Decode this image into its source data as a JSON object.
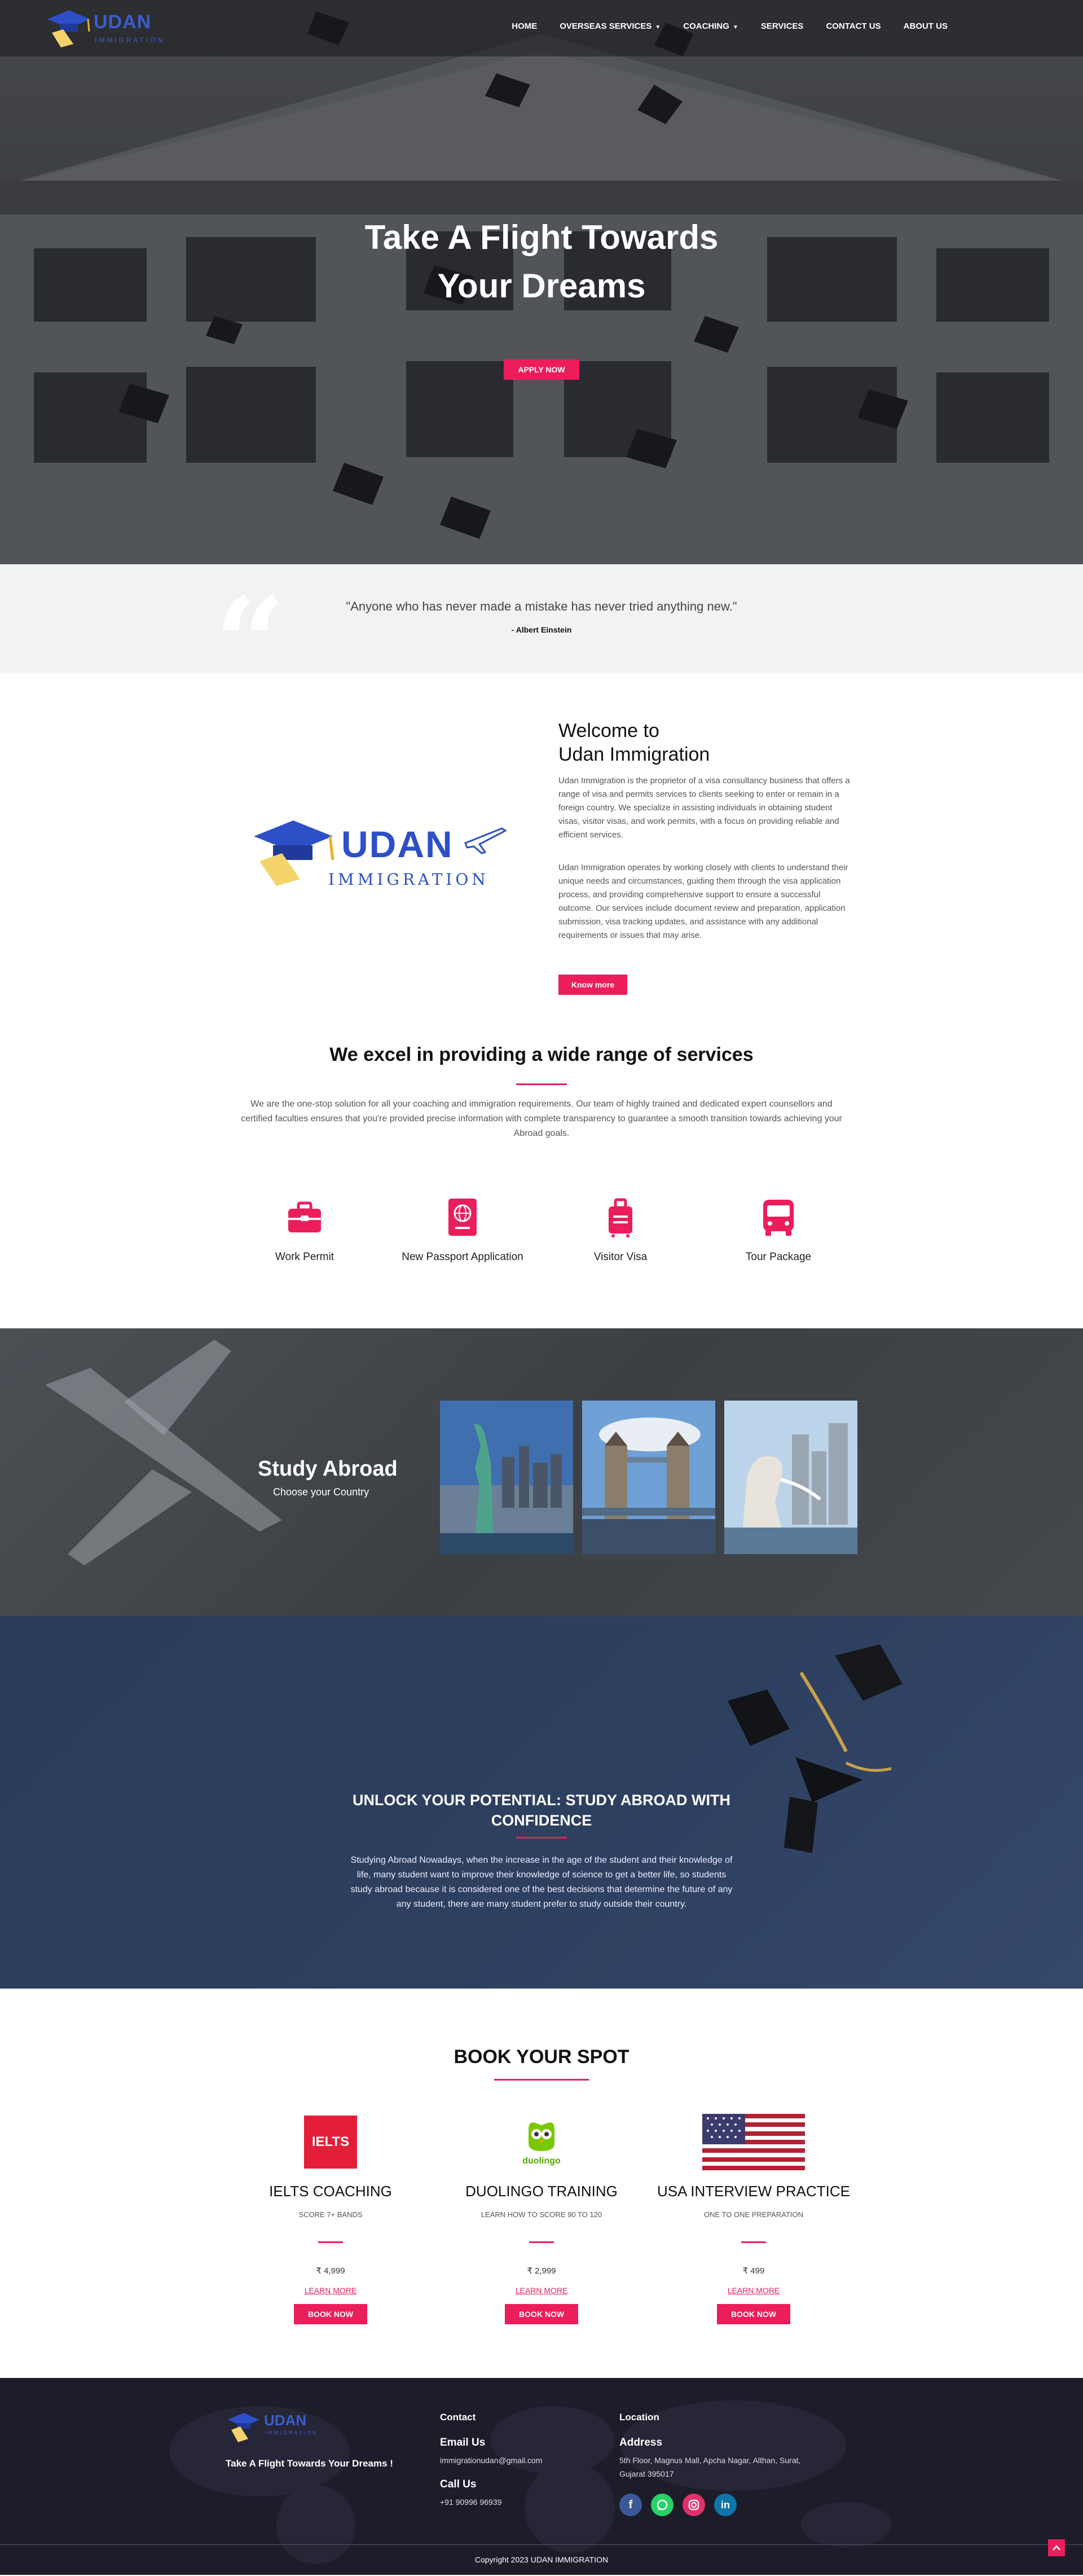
{
  "brand": {
    "name": "UDAN",
    "tagline": "IMMIGRATION"
  },
  "nav": {
    "items": [
      {
        "label": "HOME",
        "dropdown": false,
        "active": true
      },
      {
        "label": "OVERSEAS SERVICES",
        "dropdown": true,
        "active": false
      },
      {
        "label": "COACHING",
        "dropdown": true,
        "active": false
      },
      {
        "label": "SERVICES",
        "dropdown": false,
        "active": false
      },
      {
        "label": "CONTACT US",
        "dropdown": false,
        "active": false
      },
      {
        "label": "ABOUT US",
        "dropdown": false,
        "active": false
      }
    ]
  },
  "hero": {
    "title_line1": "Take A Flight Towards",
    "title_line2": "Your Dreams",
    "button": "APPLY NOW"
  },
  "quote": {
    "text": "\"Anyone who has never made a mistake has never tried anything new.\"",
    "author": "- Albert Einstein"
  },
  "welcome": {
    "heading_line1": "Welcome to",
    "heading_line2": "Udan Immigration",
    "paragraph1": "Udan Immigration is the proprietor of a visa consultancy business that offers a range of visa and permits services to clients seeking to enter or remain in a foreign country. We specialize in assisting individuals in obtaining student visas, visitor visas, and work permits, with a focus on providing reliable and efficient services.",
    "paragraph2": "Udan Immigration operates by working closely with clients to understand their unique needs and circumstances, guiding them through the visa application process, and providing comprehensive support to ensure a successful outcome. Our services include document review and preparation, application submission, visa tracking updates, and assistance with any additional requirements or issues that may arise.",
    "button": "Know more"
  },
  "services": {
    "heading": "We excel in providing a wide range of services",
    "description": "We are the one-stop solution for all your coaching and immigration requirements. Our team of highly trained and dedicated expert counsellors and certified faculties ensures that you're provided precise information with complete transparency to guarantee a smooth transition towards achieving your Abroad goals.",
    "items": [
      {
        "label": "Work Permit",
        "icon": "briefcase-icon"
      },
      {
        "label": "New Passport Application",
        "icon": "passport-icon"
      },
      {
        "label": "Visitor Visa",
        "icon": "luggage-icon"
      },
      {
        "label": "Tour Package",
        "icon": "bus-icon"
      }
    ]
  },
  "study_abroad": {
    "title": "Study Abroad",
    "subtitle": "Choose your Country",
    "countries": [
      "statue-of-liberty-image",
      "tower-bridge-image",
      "merlion-image"
    ]
  },
  "unlock": {
    "heading": "UNLOCK YOUR POTENTIAL: STUDY ABROAD WITH CONFIDENCE",
    "paragraph": "Studying Abroad Nowadays, when the increase in the age of the student and their knowledge of life, many student want to improve their knowledge of science to get a better life, so students study abroad because it is considered one of the best decisions that determine the future of any any student, there are many student prefer to study outside their country."
  },
  "booking": {
    "heading": "BOOK YOUR SPOT",
    "cards": [
      {
        "logo_text": "IELTS",
        "title": "IELTS COACHING",
        "subtitle": "SCORE 7+ BANDS",
        "price": "₹  4,999",
        "learn": "LEARN MORE",
        "button": "BOOK NOW"
      },
      {
        "logo_text": "duolingo",
        "title": "DUOLINGO TRAINING",
        "subtitle": "LEARN HOW TO SCORE 90 TO 120",
        "price": "₹  2,999",
        "learn": "LEARN MORE",
        "button": "BOOK NOW"
      },
      {
        "logo_text": "",
        "title": "USA INTERVIEW PRACTICE",
        "subtitle": "ONE TO ONE PREPARATION",
        "price": "₹  499",
        "learn": "LEARN MORE",
        "button": "BOOK NOW"
      }
    ]
  },
  "footer": {
    "tagline": "Take A Flight Towards Your Dreams !",
    "contact_heading": "Contact",
    "email_label": "Email Us",
    "email": "immigrationudan@gmail.com",
    "call_label": "Call Us",
    "phone": "+91 90996 96939",
    "location_heading": "Location",
    "address_label": "Address",
    "address_line1": "5th Floor, Magnus Mall, Apcha Nagar, Althan, Surat,",
    "address_line2": "Gujarat 395017",
    "copyright": "Copyright    2023 UDAN IMMIGRATION"
  },
  "colors": {
    "accent": "#ec1d5b",
    "brand_blue": "#3b5ccc",
    "footer_bg": "#1d1d2a"
  }
}
